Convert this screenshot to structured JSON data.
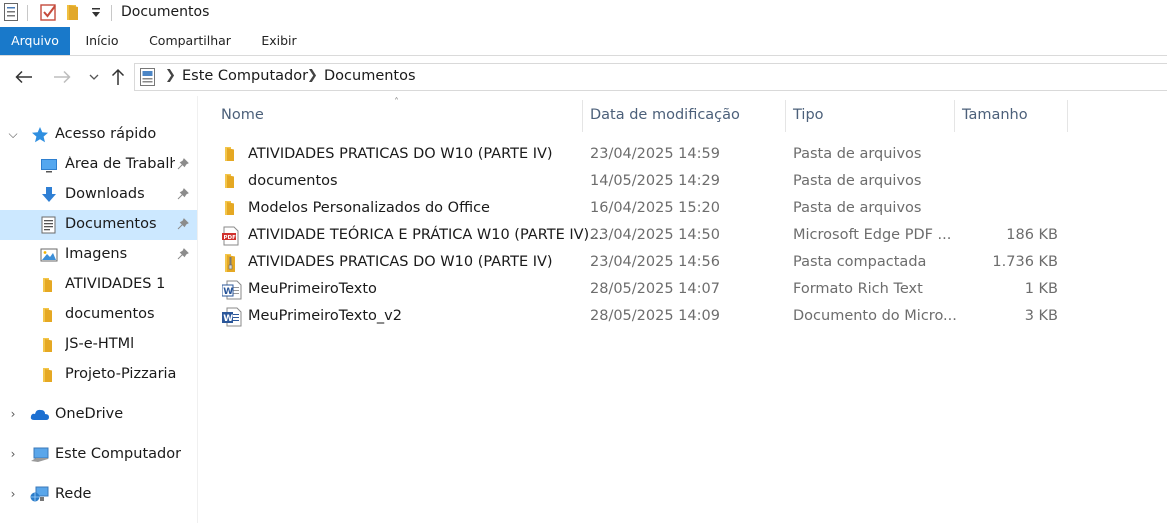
{
  "window": {
    "title": "Documentos"
  },
  "ribbon": {
    "tabs": [
      {
        "label": "Arquivo",
        "active": true
      },
      {
        "label": "Início"
      },
      {
        "label": "Compartilhar"
      },
      {
        "label": "Exibir"
      }
    ]
  },
  "address": {
    "crumbs": [
      "Este Computador",
      "Documentos"
    ]
  },
  "sidebar": {
    "quick_access": "Acesso rápido",
    "items": [
      {
        "label": "Área de Trabalho",
        "icon": "desktop-icon",
        "pinned": true
      },
      {
        "label": "Downloads",
        "icon": "download-icon",
        "pinned": true
      },
      {
        "label": "Documentos",
        "icon": "documents-icon",
        "pinned": true,
        "selected": true
      },
      {
        "label": "Imagens",
        "icon": "pictures-icon",
        "pinned": true
      },
      {
        "label": "ATIVIDADES 1",
        "icon": "folder-icon"
      },
      {
        "label": "documentos",
        "icon": "folder-icon"
      },
      {
        "label": "JS-e-HTMl",
        "icon": "folder-icon"
      },
      {
        "label": "Projeto-Pizzaria",
        "icon": "folder-icon"
      }
    ],
    "onedrive": "OneDrive",
    "this_pc": "Este Computador",
    "network": "Rede"
  },
  "columns": {
    "name": "Nome",
    "date": "Data de modificação",
    "type": "Tipo",
    "size": "Tamanho"
  },
  "files": [
    {
      "name": "ATIVIDADES PRATICAS DO W10 (PARTE IV)",
      "date": "23/04/2025 14:59",
      "type": "Pasta de arquivos",
      "size": "",
      "icon": "folder-icon"
    },
    {
      "name": "documentos",
      "date": "14/05/2025 14:29",
      "type": "Pasta de arquivos",
      "size": "",
      "icon": "folder-icon"
    },
    {
      "name": "Modelos Personalizados do Office",
      "date": "16/04/2025 15:20",
      "type": "Pasta de arquivos",
      "size": "",
      "icon": "folder-icon"
    },
    {
      "name": "ATIVIDADE TEÓRICA E PRÁTICA W10 (PARTE IV)...",
      "date": "23/04/2025 14:50",
      "type": "Microsoft Edge PDF ...",
      "size": "186 KB",
      "icon": "pdf-icon"
    },
    {
      "name": "ATIVIDADES PRATICAS DO W10 (PARTE IV)",
      "date": "23/04/2025 14:56",
      "type": "Pasta compactada",
      "size": "1.736 KB",
      "icon": "zip-folder-icon"
    },
    {
      "name": "MeuPrimeiroTexto",
      "date": "28/05/2025 14:07",
      "type": "Formato Rich Text",
      "size": "1 KB",
      "icon": "rtf-document-icon"
    },
    {
      "name": "MeuPrimeiroTexto_v2",
      "date": "28/05/2025 14:09",
      "type": "Documento do Micro...",
      "size": "3 KB",
      "icon": "word-document-icon"
    }
  ]
}
